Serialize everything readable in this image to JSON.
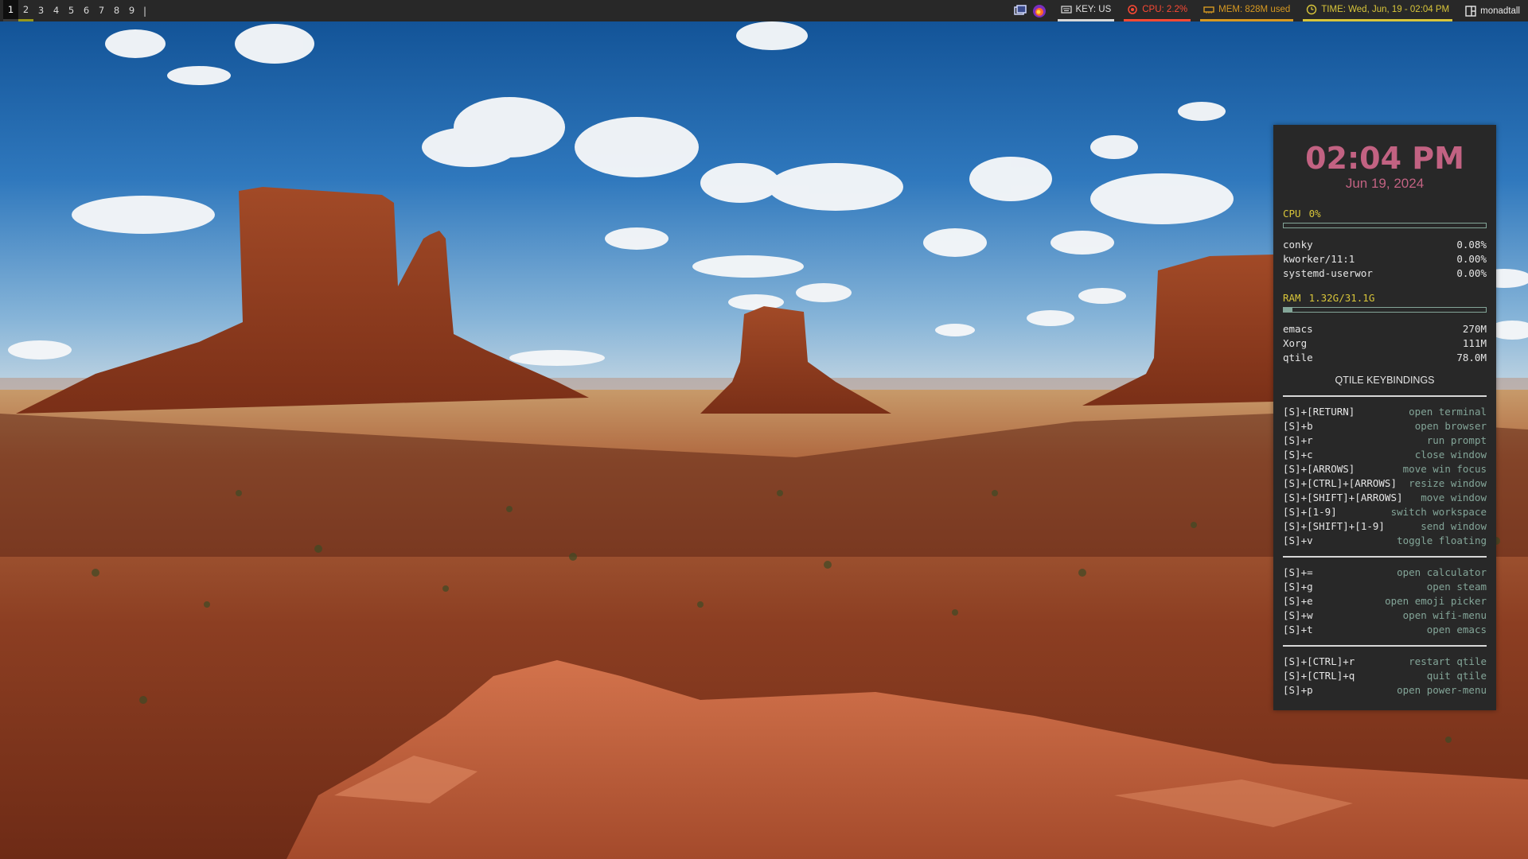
{
  "workspaces": [
    {
      "label": "1",
      "state": "active"
    },
    {
      "label": "2",
      "state": "occupied"
    },
    {
      "label": "3",
      "state": "empty"
    },
    {
      "label": "4",
      "state": "empty"
    },
    {
      "label": "5",
      "state": "empty"
    },
    {
      "label": "6",
      "state": "empty"
    },
    {
      "label": "7",
      "state": "empty"
    },
    {
      "label": "8",
      "state": "empty"
    },
    {
      "label": "9",
      "state": "empty"
    }
  ],
  "topbar": {
    "separator": "|",
    "keyboard": "KEY: US",
    "cpu": "CPU: 2.2%",
    "mem": "MEM: 828M used",
    "time": "TIME: Wed, Jun, 19 - 02:04 PM",
    "layout": "monadtall",
    "colors": {
      "cpu": "#fb4934",
      "mem": "#d79921",
      "time": "#d8c53a",
      "key": "#d8d8d8"
    },
    "tray_icons": [
      "window-switcher-icon",
      "firefox-icon"
    ]
  },
  "conky": {
    "time": "02:04 PM",
    "date": "Jun 19, 2024",
    "cpu": {
      "label": "CPU",
      "value": "0%",
      "level": 0.0
    },
    "cpu_procs": [
      {
        "name": "conky",
        "value": "0.08%"
      },
      {
        "name": "kworker/11:1",
        "value": "0.00%"
      },
      {
        "name": "systemd-userwor",
        "value": "0.00%"
      }
    ],
    "ram": {
      "label": "RAM",
      "value": "1.32G/31.1G",
      "level": 0.042
    },
    "ram_procs": [
      {
        "name": "emacs",
        "value": "270M"
      },
      {
        "name": "Xorg",
        "value": "111M"
      },
      {
        "name": "qtile",
        "value": "78.0M"
      }
    ],
    "keybindings_title": "QTILE KEYBINDINGS",
    "kb_groups": [
      [
        {
          "key": "[S]+[RETURN]",
          "desc": "open terminal"
        },
        {
          "key": "[S]+b",
          "desc": "open browser"
        },
        {
          "key": "[S]+r",
          "desc": "run prompt"
        },
        {
          "key": "[S]+c",
          "desc": "close window"
        },
        {
          "key": "[S]+[ARROWS]",
          "desc": "move win focus"
        },
        {
          "key": "[S]+[CTRL]+[ARROWS]",
          "desc": "resize window"
        },
        {
          "key": "[S]+[SHIFT]+[ARROWS]",
          "desc": "move window"
        },
        {
          "key": "[S]+[1-9]",
          "desc": "switch workspace"
        },
        {
          "key": "[S]+[SHIFT]+[1-9]",
          "desc": "send window"
        },
        {
          "key": "[S]+v",
          "desc": "toggle floating"
        }
      ],
      [
        {
          "key": "[S]+=",
          "desc": "open calculator"
        },
        {
          "key": "[S]+g",
          "desc": "open steam"
        },
        {
          "key": "[S]+e",
          "desc": "open emoji picker"
        },
        {
          "key": "[S]+w",
          "desc": "open wifi-menu"
        },
        {
          "key": "[S]+t",
          "desc": "open emacs"
        }
      ],
      [
        {
          "key": "[S]+[CTRL]+r",
          "desc": "restart qtile"
        },
        {
          "key": "[S]+[CTRL]+q",
          "desc": "quit qtile"
        },
        {
          "key": "[S]+p",
          "desc": "open power-menu"
        }
      ]
    ],
    "colors": {
      "clock": "#c26282",
      "header": "#d8c53a",
      "desc": "#83a598",
      "meter": "#83a598"
    }
  }
}
